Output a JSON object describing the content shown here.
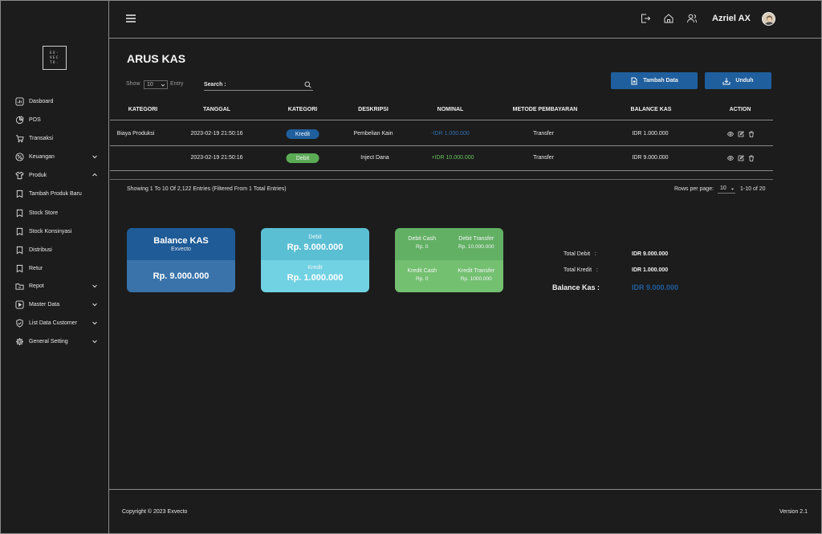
{
  "brand": {
    "logo_text": "EX-\nVEC\nTO."
  },
  "sidebar": {
    "items": [
      {
        "label": "Dasboard",
        "icon": "chart-icon"
      },
      {
        "label": "POS",
        "icon": "pie-icon"
      },
      {
        "label": "Transaksi",
        "icon": "cart-icon"
      },
      {
        "label": "Keuangan",
        "icon": "percent-icon",
        "expand": "collapsed"
      },
      {
        "label": "Produk",
        "icon": "shirt-icon",
        "expand": "expanded"
      },
      {
        "label": "Tambah Produk Baru",
        "icon": "bookmark-icon"
      },
      {
        "label": "Stock Store",
        "icon": "bookmark-icon"
      },
      {
        "label": "Stock Konsinyasi",
        "icon": "bookmark-icon"
      },
      {
        "label": "Distribusi",
        "icon": "bookmark-icon"
      },
      {
        "label": "Retur",
        "icon": "bookmark-icon"
      },
      {
        "label": "Repot",
        "icon": "folder-icon",
        "expand": "collapsed"
      },
      {
        "label": "Master Data",
        "icon": "play-icon",
        "expand": "collapsed"
      },
      {
        "label": "List Data Customer",
        "icon": "shield-check-icon",
        "expand": "collapsed"
      },
      {
        "label": "General Setting",
        "icon": "gear-icon",
        "expand": "collapsed"
      }
    ]
  },
  "header": {
    "username": "Azriel AX"
  },
  "page": {
    "title": "ARUS KAS",
    "show_label": "Show",
    "show_value": "10",
    "entry_label": "Entry",
    "search_label": "Search :",
    "search_value": "",
    "add_button": "Tambah Data",
    "download_button": "Unduh"
  },
  "table": {
    "headers": [
      "KATEGORI",
      "TANGGAL",
      "KATEGORI",
      "DESKRIPSI",
      "NOMINAL",
      "METODE PEMBAYARAN",
      "BALANCE KAS",
      "ACTION"
    ],
    "rows": [
      {
        "kategori": "Biaya Produksi",
        "tanggal": "2023-02-19 21:50:16",
        "badge": "Kredit",
        "badge_color": "#1f5f9e",
        "deskripsi": "Pembelian Kain",
        "nominal": "-IDR 1.000.000",
        "nominal_color": "#2f6fb0",
        "metode": "Transfer",
        "balance": "IDR 1.000.000"
      },
      {
        "kategori": "",
        "tanggal": "2023-02-19 21:50:16",
        "badge": "Debit",
        "badge_color": "#5bab55",
        "deskripsi": "Inject Dana",
        "nominal": "+IDR 10.000.000",
        "nominal_color": "#66c15c",
        "metode": "Transfer",
        "balance": "IDR 9.000.000"
      }
    ]
  },
  "pagination": {
    "showing": "Showing 1 To 10 Of 2,122 Entries (Filtered From 1 Total Entries)",
    "rows_per_page_label": "Rows per page:",
    "rows_per_page_value": "10",
    "range": "1-10 of 20"
  },
  "cards": {
    "balance": {
      "title": "Balance KAS",
      "subtitle": "Exvecto",
      "value": "Rp. 9.000.000"
    },
    "debit_kredit": {
      "debit_label": "Debit",
      "debit_value": "Rp. 9.000.000",
      "kredit_label": "Kredit",
      "kredit_value": "Rp. 1.000.000"
    },
    "cash_transfer": {
      "debit_cash_label": "Debit Cash",
      "debit_cash_value": "Rp. 0",
      "debit_transfer_label": "Debit Transfer",
      "debit_transfer_value": "Rp. 10.000.000",
      "kredit_cash_label": "Kredit Cash",
      "kredit_cash_value": "Rp. 0",
      "kredit_transfer_label": "Kredit Transfer",
      "kredit_transfer_value": "Rp. 1000.000"
    }
  },
  "summary": {
    "total_debit_label": "Total Debit   :",
    "total_debit_value": "IDR 9.000.000",
    "total_kredit_label": "Total Kredit   :",
    "total_kredit_value": "IDR 1.000.000",
    "balance_label": "Balance Kas :",
    "balance_value": "IDR 9.000.000",
    "balance_color": "#1f5f9e"
  },
  "footer": {
    "copyright": "Copyright © 2023 Exvecto",
    "version": "Version 2.1"
  }
}
